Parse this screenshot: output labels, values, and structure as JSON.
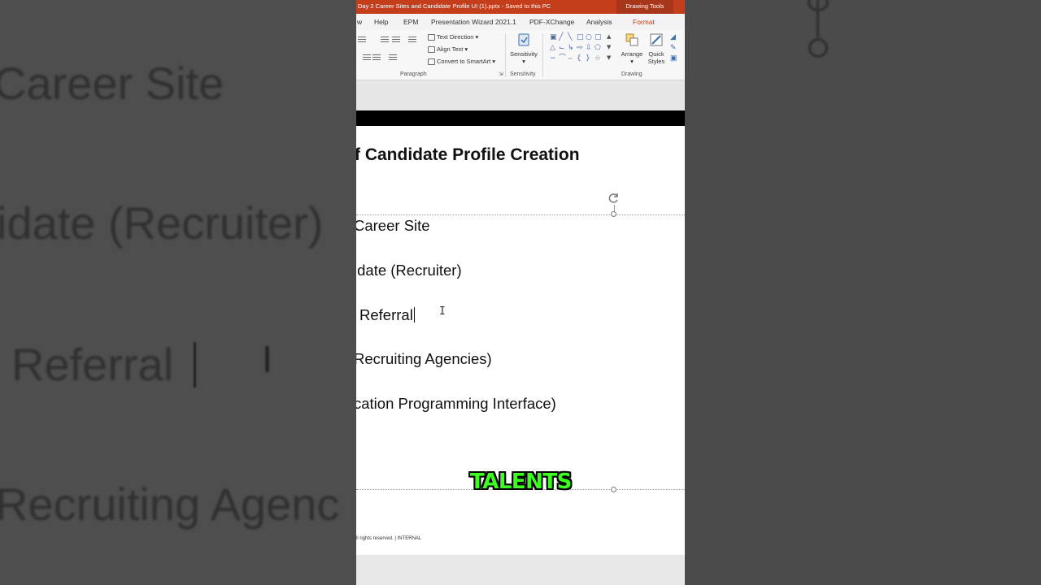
{
  "window": {
    "document_title": "Day 2 Career Sites and Candidate Profile UI (1).pptx  -  Saved to this PC",
    "context_tab_group": "Drawing Tools"
  },
  "ribbon_tabs": [
    {
      "label": "w",
      "active": false
    },
    {
      "label": "Help",
      "active": false
    },
    {
      "label": "EPM",
      "active": false
    },
    {
      "label": "Presentation Wizard 2021.1",
      "active": false
    },
    {
      "label": "PDF-XChange",
      "active": false
    },
    {
      "label": "Analysis",
      "active": false
    },
    {
      "label": "Format",
      "active": true
    }
  ],
  "ribbon": {
    "text_direction": "Text Direction",
    "align_text": "Align Text",
    "convert_to_smartart": "Convert to SmartArt",
    "sensitivity_button": "Sensitivity",
    "arrange_button": "Arrange",
    "quick_styles_button": "Quick Styles",
    "groups": {
      "paragraph": "Paragraph",
      "sensitivity": "Sensitivity",
      "drawing": "Drawing"
    }
  },
  "slide": {
    "title": "f Candidate Profile Creation",
    "bullets": [
      "Career Site",
      "idate (Recruiter)",
      "Referral",
      "Recruiting Agencies)",
      "cation Programming Interface)"
    ],
    "footer": "ll rights reserved.  |   INTERNAL"
  },
  "caption": "TALENTS",
  "backdrop_text": [
    "Career Site",
    "idate (Recruiter)",
    "Referral",
    "Recruiting Agenc"
  ],
  "colors": {
    "accent": "#c43e1c",
    "caption": "#3dff1f"
  }
}
